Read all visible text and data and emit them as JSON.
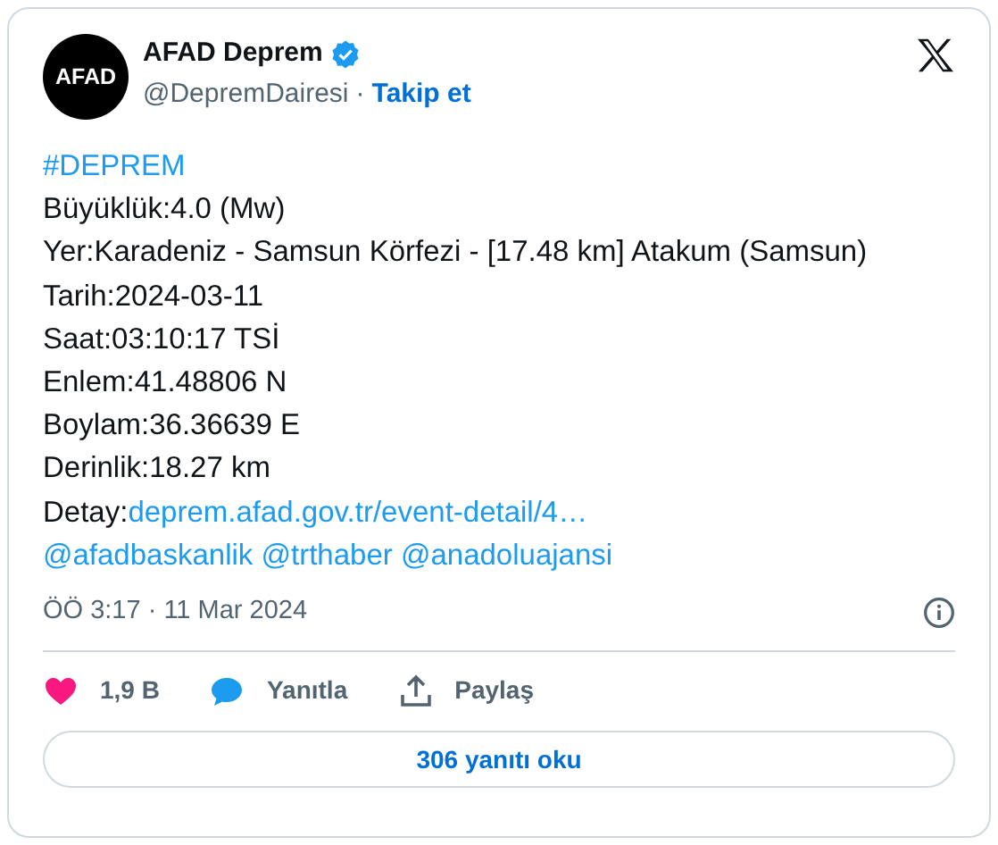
{
  "author": {
    "avatar_text": "AFAD",
    "name": "AFAD Deprem",
    "verified": true,
    "handle": "@DepremDairesi",
    "separator": "·",
    "follow": "Takip et"
  },
  "lines": [
    {
      "kind": "plain",
      "segments": [
        {
          "text": "#DEPREM",
          "link": true
        }
      ]
    },
    {
      "kind": "plain",
      "segments": [
        {
          "text": "Büyüklük:4.0 (Mw)",
          "link": false
        }
      ]
    },
    {
      "kind": "plain",
      "segments": [
        {
          "text": "Yer:Karadeniz - Samsun Körfezi - [17.48 km] Atakum (Samsun)",
          "link": false
        }
      ]
    },
    {
      "kind": "plain",
      "segments": [
        {
          "text": "Tarih:2024-03-11",
          "link": false
        }
      ]
    },
    {
      "kind": "plain",
      "segments": [
        {
          "text": "Saat:03:10:17 TSİ",
          "link": false
        }
      ]
    },
    {
      "kind": "plain",
      "segments": [
        {
          "text": "Enlem:41.48806 N",
          "link": false
        }
      ]
    },
    {
      "kind": "plain",
      "segments": [
        {
          "text": "Boylam:36.36639 E",
          "link": false
        }
      ]
    },
    {
      "kind": "plain",
      "segments": [
        {
          "text": "Derinlik:18.27 km",
          "link": false
        }
      ]
    },
    {
      "kind": "plain",
      "segments": [
        {
          "text": "Detay:",
          "link": false
        },
        {
          "text": "deprem.afad.gov.tr/event-detail/4…",
          "link": true
        }
      ]
    },
    {
      "kind": "mentions",
      "segments": [
        {
          "text": "@afadbaskanlik",
          "link": true
        },
        {
          "text": "@trthaber",
          "link": true
        },
        {
          "text": "@anadoluajansi",
          "link": true
        }
      ]
    }
  ],
  "timestamp": "ÖÖ 3:17 · 11 Mar 2024",
  "actions": [
    {
      "kind": "like",
      "label": "1,9 B"
    },
    {
      "kind": "reply",
      "label": "Yanıtla"
    },
    {
      "kind": "share",
      "label": "Paylaş"
    }
  ],
  "read_replies": "306 yanıtı oku"
}
